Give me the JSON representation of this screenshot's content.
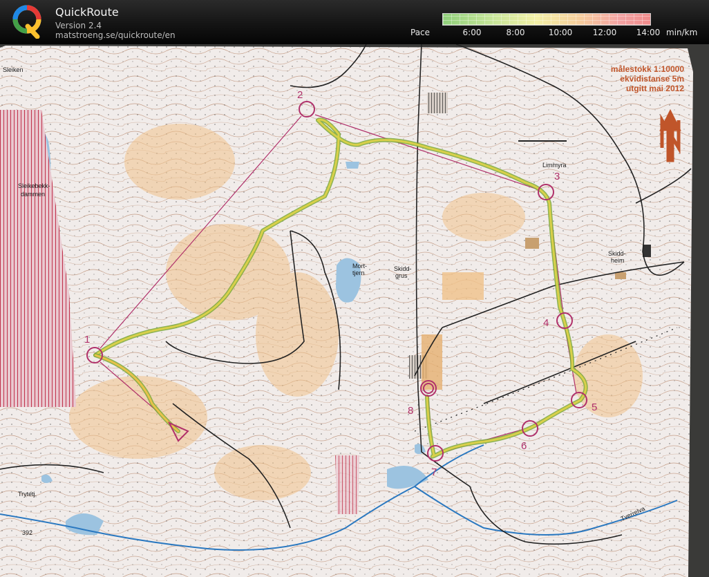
{
  "app": {
    "title": "QuickRoute",
    "version": "Version 2.4",
    "url": "matstroeng.se/quickroute/en",
    "logo_letter": "Q"
  },
  "pace": {
    "label": "Pace",
    "ticks": [
      "6:00",
      "8:00",
      "10:00",
      "12:00",
      "14:00"
    ],
    "unit": "min/km",
    "colors": [
      "#8fcf7a",
      "#c9e69a",
      "#f3f0a6",
      "#f6cf9c",
      "#f3a3a3",
      "#f08a8a"
    ]
  },
  "map": {
    "legend_lines": [
      "målestokk 1:10000",
      "ekvidistanse    5m",
      "utgitt   mai 2012"
    ],
    "place_names": {
      "sleikebekk_1": "Sleikebekk-",
      "sleikebekk_2": "dammen",
      "mort_1": "Mort-",
      "mort_2": "tjern",
      "grus_1": "Skidd-",
      "grus_2": "grus",
      "skiddheim_1": "Skidd-",
      "skiddheim_2": "heim",
      "tryteli": "Trytetj.",
      "height": "392",
      "limmyra": "Limmyra",
      "sleiken": "Sleiken",
      "tverrelva": "Tverrelva"
    },
    "controls": [
      {
        "label": "1",
        "type": "circle"
      },
      {
        "label": "2",
        "type": "circle"
      },
      {
        "label": "3",
        "type": "circle"
      },
      {
        "label": "4",
        "type": "circle"
      },
      {
        "label": "5",
        "type": "circle"
      },
      {
        "label": "6",
        "type": "circle"
      },
      {
        "label": "7",
        "type": "circle"
      },
      {
        "label": "8",
        "type": "circle"
      }
    ],
    "colors": {
      "paper": "#f1ecea",
      "contour": "#b07a5a",
      "water": "#9cc3e0",
      "open": "#f0c28a",
      "course": "#b0306a",
      "route_core": "#d9d04a",
      "route_edge": "#7aa83a",
      "track": "#222222"
    }
  }
}
